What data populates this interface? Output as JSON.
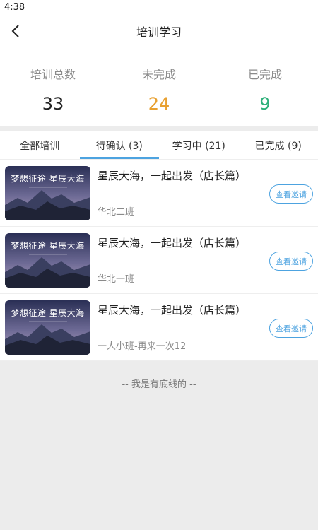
{
  "status_bar": {
    "time": "4:38"
  },
  "nav": {
    "title": "培训学习",
    "back_icon": "chevron-left-icon"
  },
  "summary": [
    {
      "label": "培训总数",
      "value": "33",
      "color": "#222222"
    },
    {
      "label": "未完成",
      "value": "24",
      "color": "#e8a030"
    },
    {
      "label": "已完成",
      "value": "9",
      "color": "#2eb07a"
    }
  ],
  "tabs": [
    {
      "label": "全部培训",
      "active": false
    },
    {
      "label": "待确认 (3)",
      "active": true
    },
    {
      "label": "学习中 (21)",
      "active": false
    },
    {
      "label": "已完成 (9)",
      "active": false
    }
  ],
  "items": [
    {
      "thumb_text": "梦想征途 星辰大海",
      "title": "星辰大海，一起出发（店长篇）",
      "subtitle": "华北二班",
      "button": "查看邀请"
    },
    {
      "thumb_text": "梦想征途 星辰大海",
      "title": "星辰大海，一起出发（店长篇）",
      "subtitle": "华北一班",
      "button": "查看邀请"
    },
    {
      "thumb_text": "梦想征途 星辰大海",
      "title": "星辰大海，一起出发（店长篇）",
      "subtitle": "一人小班-再来一次12",
      "button": "查看邀请"
    }
  ],
  "footer": {
    "text": "-- 我是有底线的 --"
  },
  "colors": {
    "accent": "#4da3e0"
  }
}
